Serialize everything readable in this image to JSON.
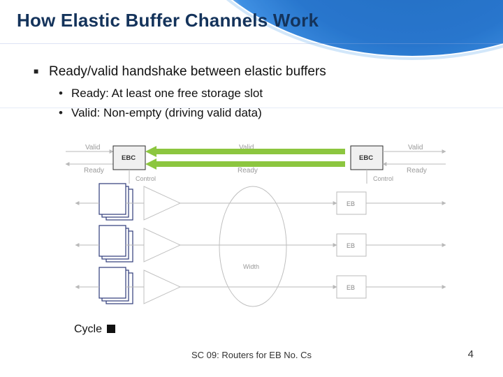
{
  "title": "How Elastic Buffer Channels Work",
  "bullets": {
    "main": "Ready/valid handshake between elastic buffers",
    "sub1": "Ready: At least one free storage slot",
    "sub2": "Valid: Non-empty (driving valid data)"
  },
  "diagram": {
    "labels": {
      "valid": "Valid",
      "ready": "Ready",
      "control": "Control",
      "ebc": "EBC",
      "eb": "EB",
      "width": "Width"
    }
  },
  "cycle_label": "Cycle",
  "footer": "SC 09: Routers for EB No. Cs",
  "page_number": "4"
}
